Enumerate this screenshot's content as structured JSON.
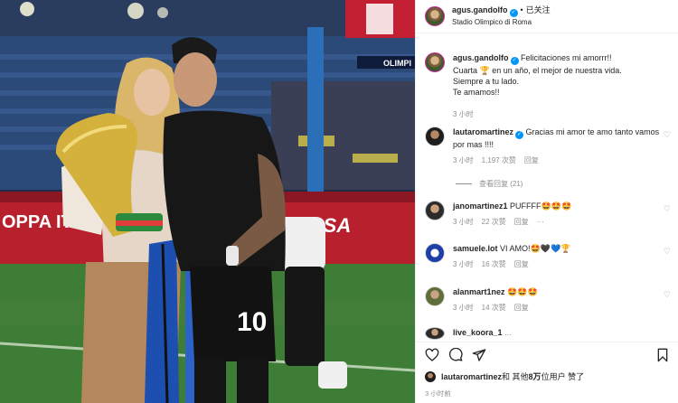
{
  "post": {
    "author": "agus.gandolfo",
    "dot": "•",
    "follow_label": "已关注",
    "location": "Stadio Olimpico di Roma"
  },
  "caption": {
    "author": "agus.gandolfo",
    "lines": [
      "Felicitaciones mi amorrr!!",
      "Cuarta 🏆 en un año, el mejor de nuestra vida.",
      "Siempre a tu lado.",
      "Te amamos!!"
    ],
    "time": "3 小时"
  },
  "comments": [
    {
      "user": "lautaromartinez",
      "text": "Gracias mi amor te amo tanto vamos por mas !!!!",
      "time": "3 小时",
      "likes": "1,197 次赞",
      "reply": "回复",
      "view_replies": "查看回复 (21)"
    },
    {
      "user": "janomartinez1",
      "text": "PUFFFF🤩🤩🤩",
      "time": "3 小时",
      "likes": "22 次赞",
      "reply": "回复",
      "more": "···"
    },
    {
      "user": "samuele.lot",
      "text": "VI AMO!🤩🖤💙🏆",
      "time": "3 小时",
      "likes": "16 次赞",
      "reply": "回复"
    },
    {
      "user": "alanmart1nez",
      "text": "🤩🤩🤩",
      "time": "3 小时",
      "likes": "14 次赞",
      "reply": "回复"
    },
    {
      "user": "live_koora_1",
      "text": "...",
      "time": ""
    }
  ],
  "likes_line": {
    "user": "lautaromartinez",
    "middle": " 和 其他 ",
    "count": "8万",
    "suffix": " 位用户 赞了"
  },
  "post_time": "3 小时前",
  "photo": {
    "banner_left": "OPPA ITA",
    "banner_right": "SSA",
    "banner_top": "OLIMPI",
    "jersey_number": "10"
  },
  "icons": {
    "like": "heart-icon",
    "comment": "comment-icon",
    "share": "share-icon",
    "save": "bookmark-icon"
  },
  "colors": {
    "accent": "#0095f6",
    "muted": "#8e8e8e",
    "text": "#262626"
  }
}
